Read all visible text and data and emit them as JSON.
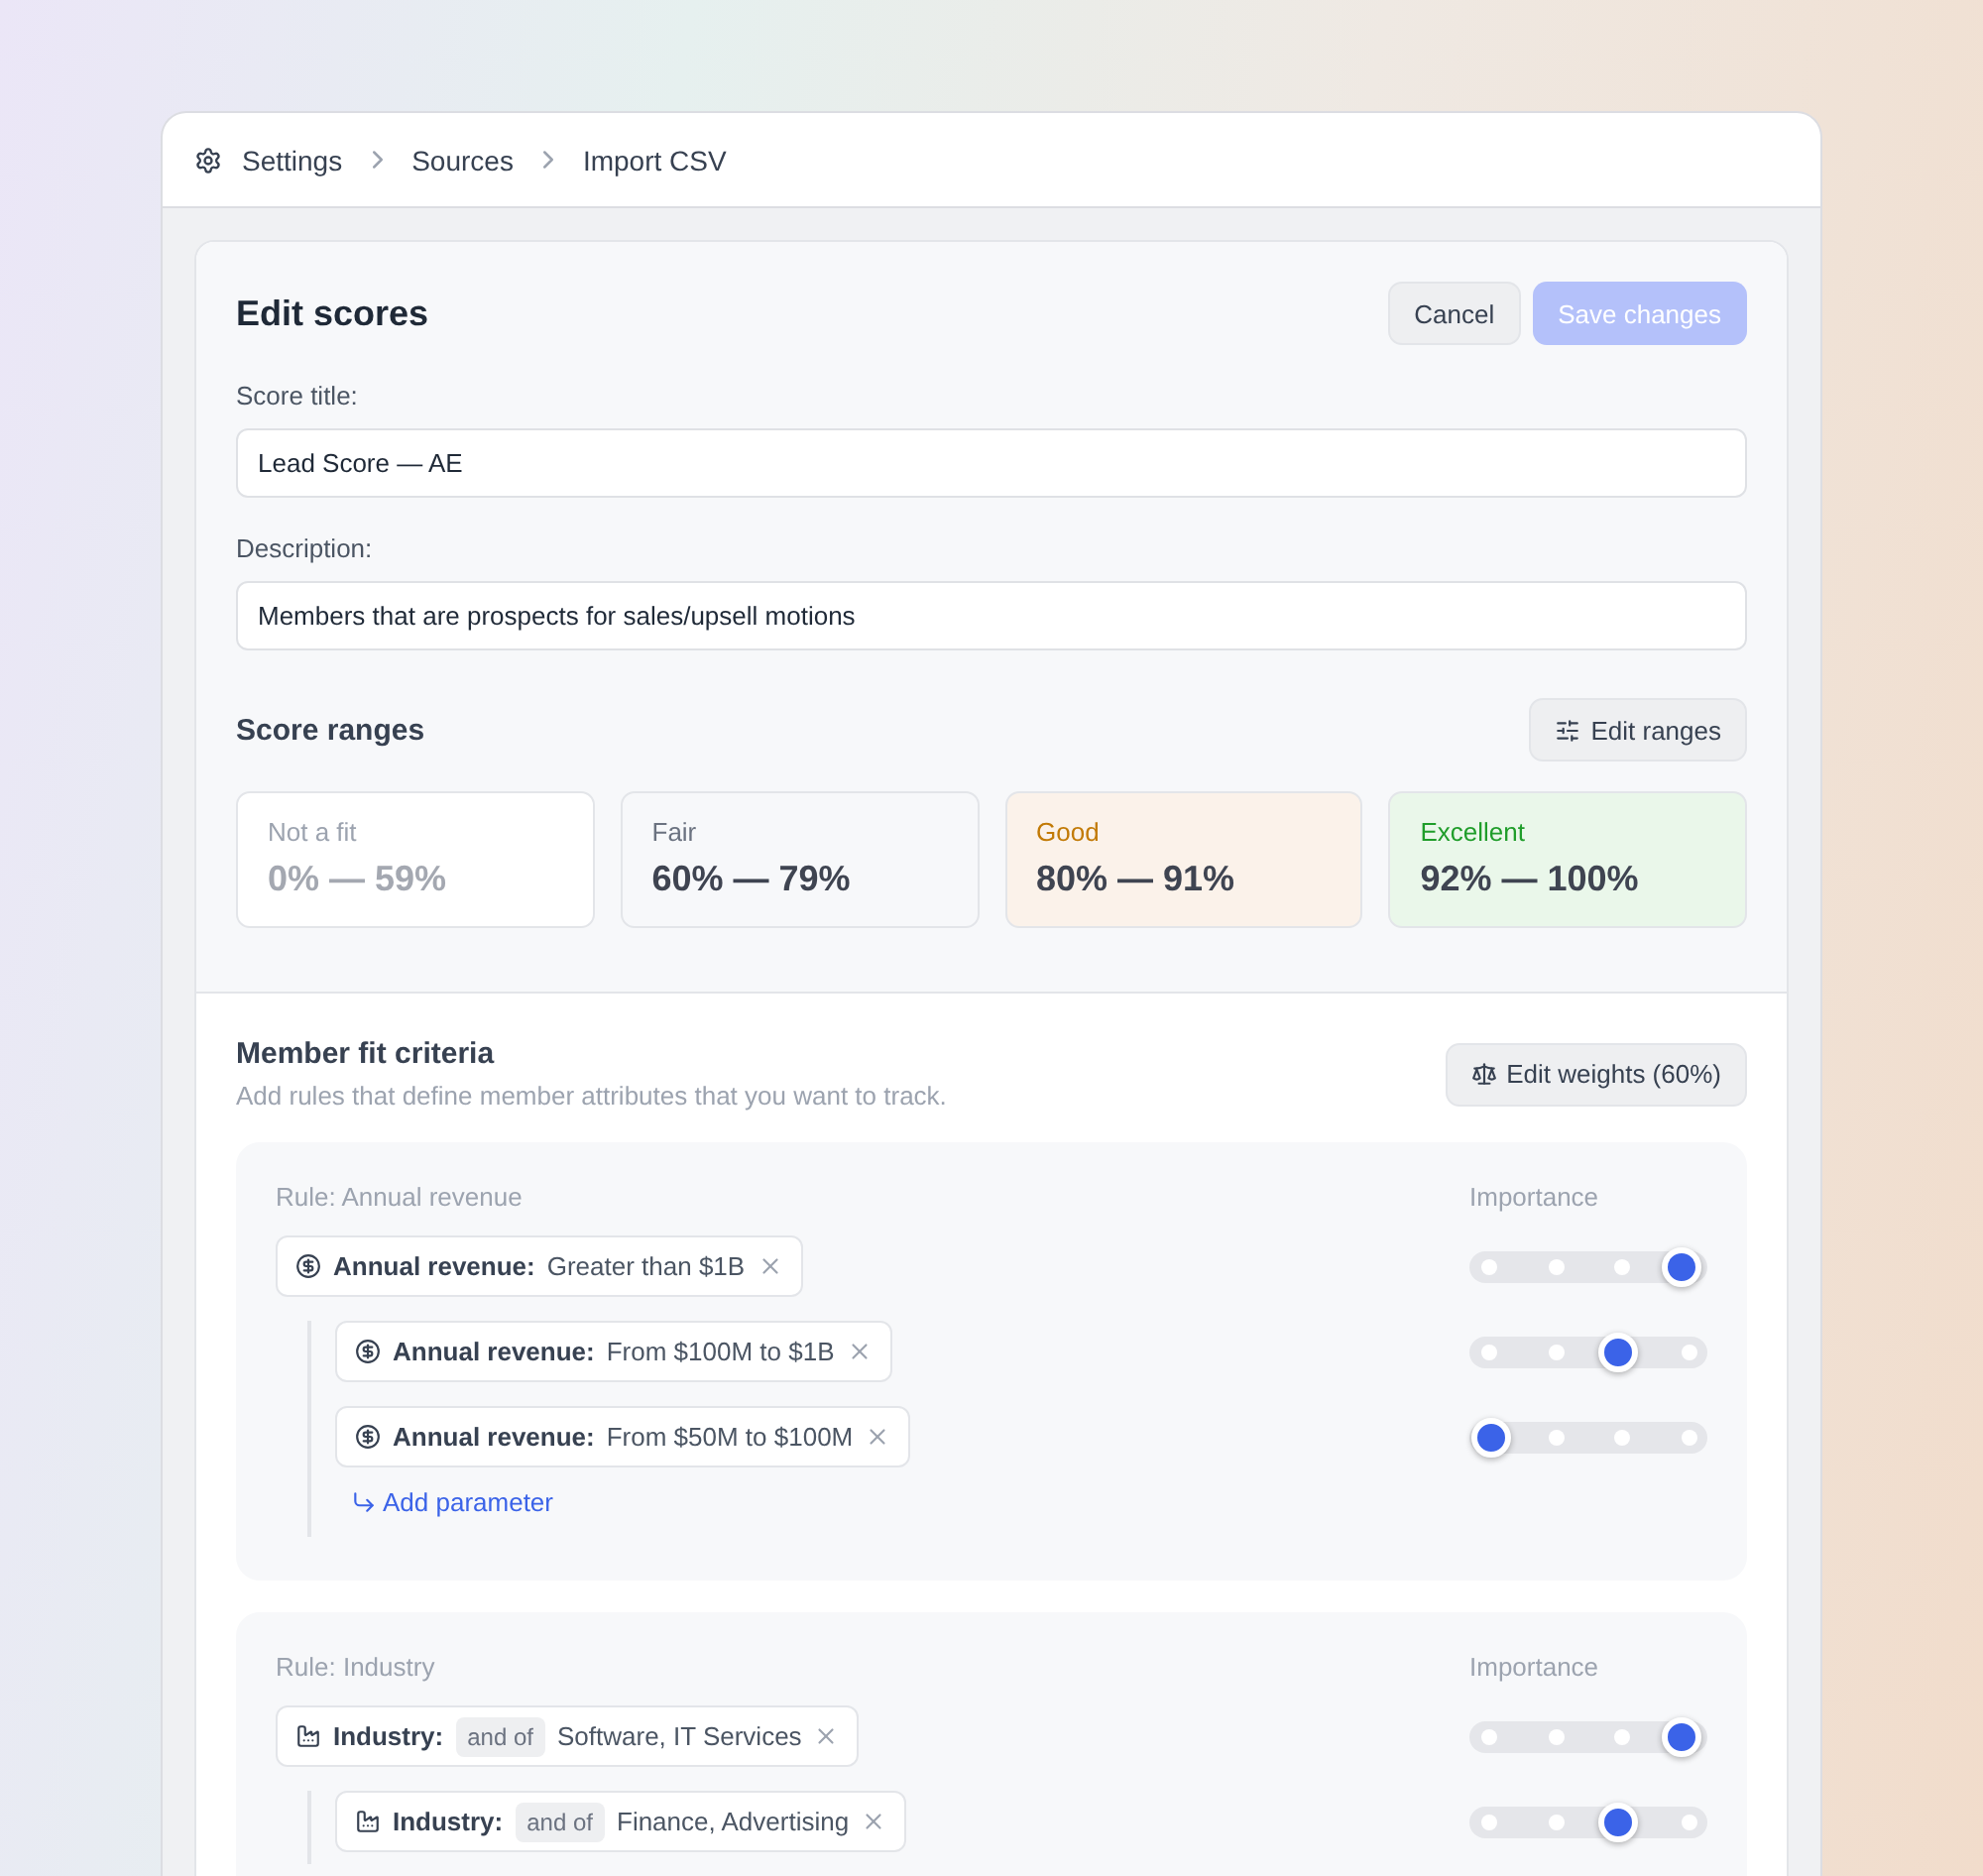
{
  "breadcrumb": [
    "Settings",
    "Sources",
    "Import CSV"
  ],
  "header": {
    "title": "Edit scores",
    "cancel": "Cancel",
    "save": "Save changes",
    "save_disabled": true
  },
  "fields": [
    {
      "label": "Score title:",
      "value": "Lead Score — AE"
    },
    {
      "label": "Description:",
      "value": "Members that are prospects for sales/upsell motions"
    }
  ],
  "score_ranges": {
    "title": "Score ranges",
    "button": "Edit ranges",
    "ranges": [
      {
        "kind": "muted",
        "label": "Not a fit",
        "range": "0% — 59%"
      },
      {
        "kind": "neutral",
        "label": "Fair",
        "range": "60% — 79%"
      },
      {
        "kind": "warning",
        "label": "Good",
        "range": "80% — 91%"
      },
      {
        "kind": "success",
        "label": "Excellent",
        "range": "92% — 100%"
      }
    ]
  },
  "criteria": {
    "title": "Member fit criteria",
    "subtitle": "Add rules that define member attributes that you want to track.",
    "button": "Edit weights (60%)",
    "rules": [
      {
        "kind": "revenue",
        "title": "Rule: Annual revenue",
        "importance_label": "Importance",
        "add_parameter": "Add parameter",
        "params": [
          {
            "label": "Annual revenue:",
            "value": "Greater than $1B",
            "level": 1,
            "children": [
              {
                "label": "Annual revenue:",
                "value": "From $100M to $1B",
                "level": 0.667
              },
              {
                "label": "Annual revenue:",
                "value": "From $50M to $100M",
                "level": 0
              }
            ]
          }
        ]
      },
      {
        "kind": "industry",
        "title": "Rule: Industry",
        "importance_label": "Importance",
        "params": [
          {
            "label": "Industry:",
            "operator": "and of",
            "value": "Software, IT Services",
            "level": 1,
            "children": [
              {
                "label": "Industry:",
                "operator": "and of",
                "value": "Finance, Advertising",
                "level": 0.667
              }
            ]
          }
        ]
      }
    ]
  }
}
